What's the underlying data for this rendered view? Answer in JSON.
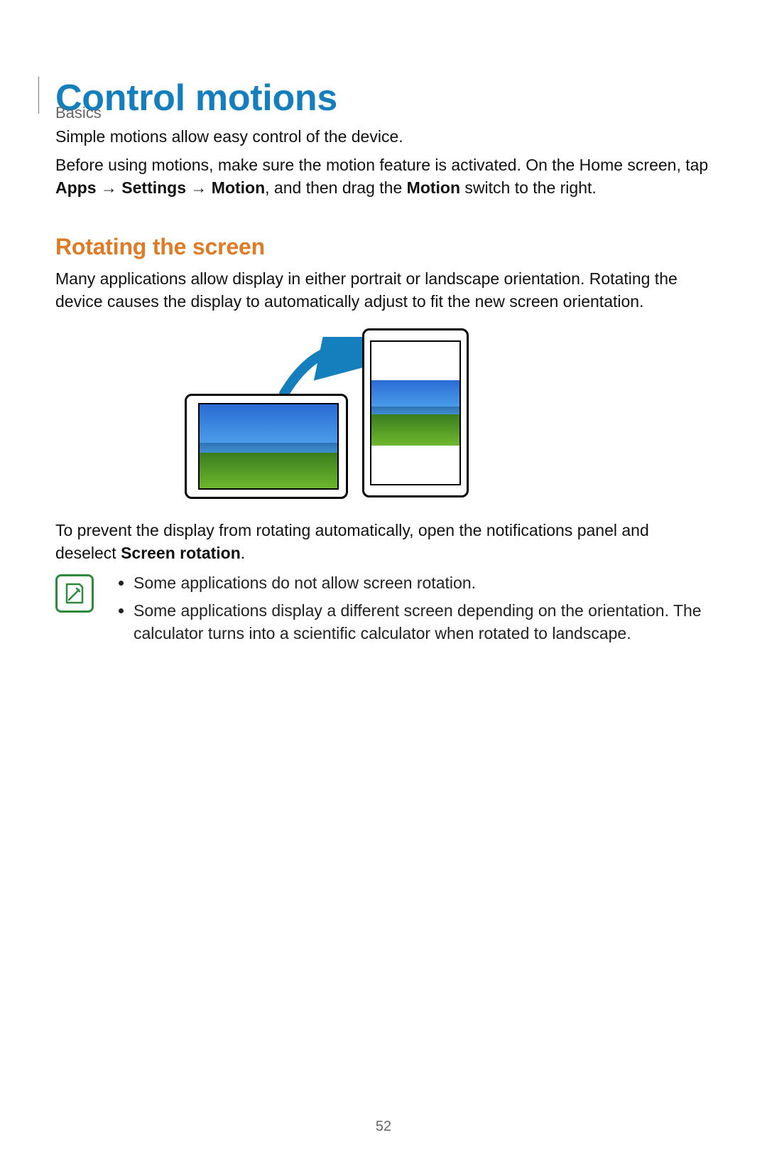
{
  "chapter": "Basics",
  "title": "Control motions",
  "intro1": "Simple motions allow easy control of the device.",
  "intro2_pre": "Before using motions, make sure the motion feature is activated. On the Home screen, tap ",
  "intro2_b1": "Apps",
  "intro2_arrow": " → ",
  "intro2_b2": "Settings",
  "intro2_b3": "Motion",
  "intro2_mid": ", and then drag the ",
  "intro2_b4": "Motion",
  "intro2_post": " switch to the right.",
  "subhead": "Rotating the screen",
  "rot_p1": "Many applications allow display in either portrait or landscape orientation. Rotating the device causes the display to automatically adjust to fit the new screen orientation.",
  "rot_p2_pre": "To prevent the display from rotating automatically, open the notifications panel and deselect ",
  "rot_p2_bold": "Screen rotation",
  "rot_p2_post": ".",
  "note_items": {
    "0": "Some applications do not allow screen rotation.",
    "1": "Some applications display a different screen depending on the orientation. The calculator turns into a scientific calculator when rotated to landscape."
  },
  "page_number": "52"
}
